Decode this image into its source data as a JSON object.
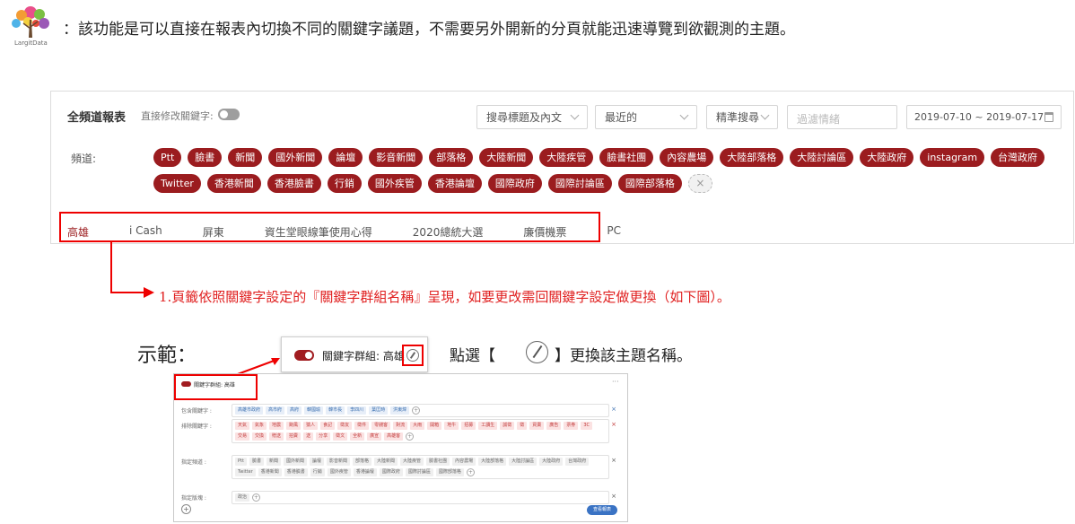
{
  "logo": {
    "icon": "tree-logo-icon",
    "text": "LargitData"
  },
  "intro_text": "：該功能是可以直接在報表內切換不同的關鍵字議題，不需要另外開新的分頁就能迅速導覽到欲觀測的主題。",
  "panel": {
    "title": "全頻道報表",
    "direct_edit_label": "直接修改關鍵字:",
    "selects": [
      {
        "value": "搜尋標題及內文"
      },
      {
        "value": "最近的"
      },
      {
        "value": "精準搜尋"
      }
    ],
    "filter_placeholder": "過濾情緒",
    "date_range": "2019-07-10 ~ 2019-07-17",
    "channel_label": "頻道:",
    "channels": [
      "Ptt",
      "臉書",
      "新聞",
      "國外新聞",
      "論壇",
      "影音新聞",
      "部落格",
      "大陸新聞",
      "大陸疾管",
      "臉書社團",
      "內容農場",
      "大陸部落格",
      "大陸討論區",
      "大陸政府",
      "instagram",
      "台灣政府",
      "Twitter",
      "香港新聞",
      "香港臉書",
      "行銷",
      "國外疾管",
      "香港論壇",
      "國際政府",
      "國際討論區",
      "國際部落格"
    ],
    "add_symbol": "×",
    "tabs": [
      "高雄",
      "i Cash",
      "屏東",
      "資生堂眼線筆使用心得",
      "2020總統大選",
      "廉價機票",
      "PC"
    ],
    "active_tab": "高雄"
  },
  "annotation": {
    "note": "1.頁籤依照關鍵字設定的『關鍵字群組名稱』呈現，如要更改需回關鍵字設定做更換（如下圖）。",
    "demo_label": "示範：",
    "callout_label": "關鍵字群組: 高雄",
    "instruction_prefix": "點選【",
    "instruction_suffix": "】更換該主題名稱。"
  },
  "mini": {
    "title": "關鍵字群組: 高雄",
    "dots": "···",
    "rows": [
      {
        "label": "包含關鍵字 :",
        "chips": [
          "高雄市政府",
          "高市府",
          "高府",
          "韓國瑜",
          "韓市長",
          "李四川",
          "葉匡時",
          "洪東煒"
        ],
        "style": "blue",
        "x": "×"
      },
      {
        "label": "排除關鍵字 :",
        "chips": [
          "天氣",
          "氣象",
          "地震",
          "颱風",
          "猿人",
          "食記",
          "徵友",
          "徵件",
          "零錢客",
          "對流",
          "大雨",
          "開箱",
          "地牛",
          "招募",
          "工讀生",
          "誠徵",
          "徵",
          "買賣",
          "廣告",
          "票券",
          "3C",
          "交易",
          "交換",
          "贈送",
          "拍賣",
          "送",
          "分享",
          "徵文",
          "全新",
          "廣宣",
          "高雄客"
        ],
        "style": "pink",
        "x": "×"
      },
      {
        "label": "指定頻道 :",
        "chips": [
          "Ptt",
          "臉書",
          "新聞",
          "國外新聞",
          "論壇",
          "影音新聞",
          "部落格",
          "大陸新聞",
          "大陸疾管",
          "臉書社團",
          "內容農場",
          "大陸部落格",
          "大陸討論區",
          "大陸政府",
          "台灣政府",
          "Twitter",
          "香港新聞",
          "香港臉書",
          "行銷",
          "國外疾管",
          "香港論壇",
          "國際政府",
          "國際討論區",
          "國際部落格"
        ],
        "style": "gray",
        "x": "×"
      },
      {
        "label": "指定版塊 :",
        "chips": [
          "政治"
        ],
        "style": "gray",
        "x": "×"
      }
    ],
    "button": "查看報表",
    "add": "+"
  }
}
